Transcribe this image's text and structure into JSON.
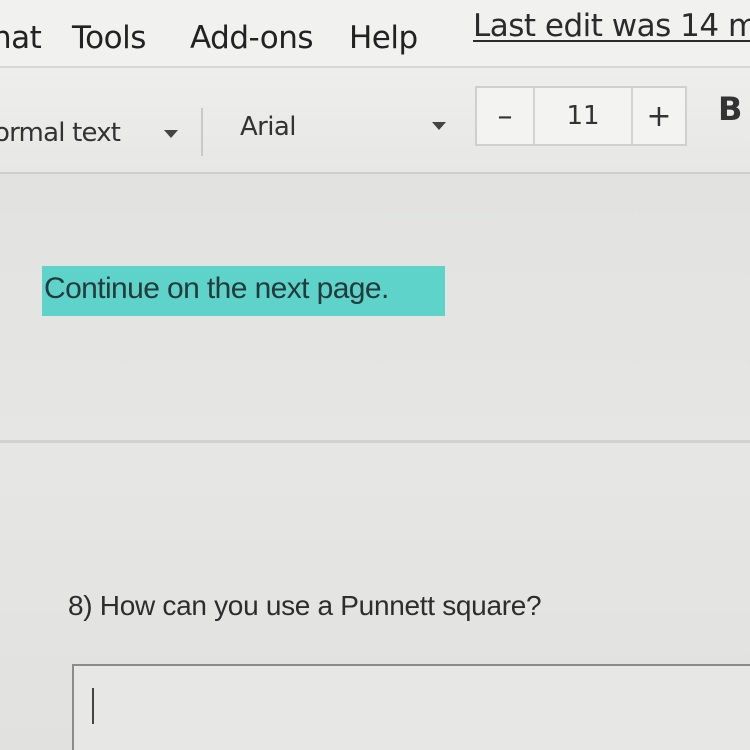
{
  "menubar": {
    "items": [
      "nat",
      "Tools",
      "Add-ons",
      "Help"
    ],
    "last_edit": "Last edit was 14 m"
  },
  "toolbar": {
    "style_value": "ormal text",
    "font_value": "Arial",
    "size_minus": "–",
    "font_size": "11",
    "size_plus": "+",
    "bold_label": "B"
  },
  "document": {
    "highlighted_text": "Continue on the next page.",
    "highlight_color": "#5ed3c9",
    "question": "8) How can you use a Punnett square?",
    "answer_value": ""
  }
}
